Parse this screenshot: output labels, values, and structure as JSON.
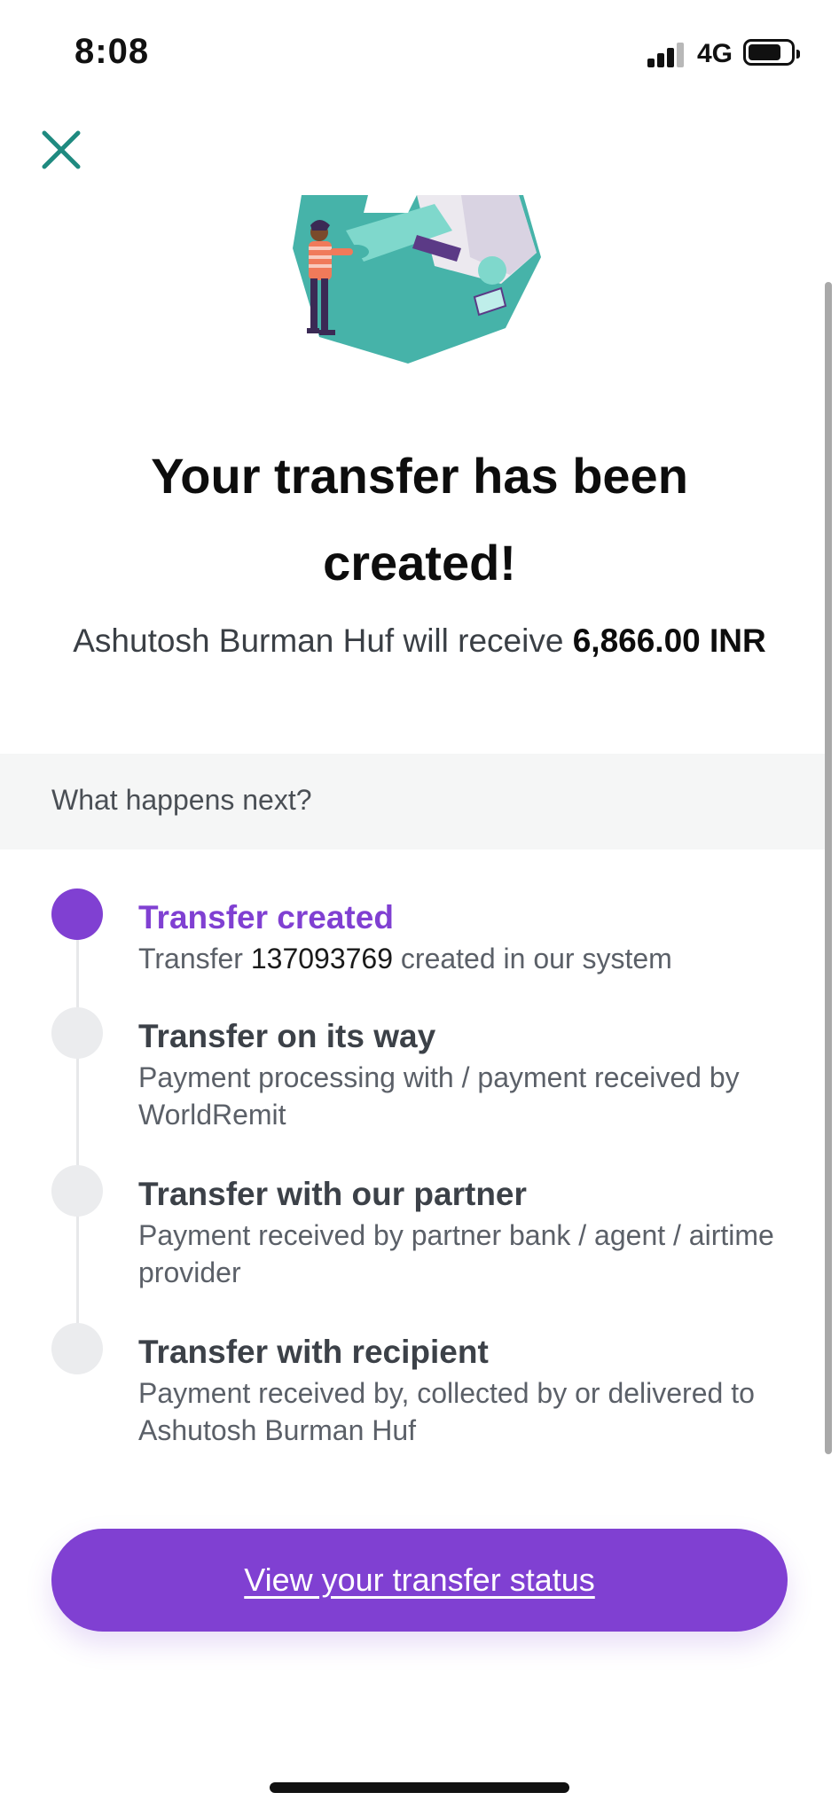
{
  "status_bar": {
    "time": "8:08",
    "network": "4G"
  },
  "header": {
    "close_icon": "close-icon"
  },
  "hero": {
    "title": "Your transfer has been created!",
    "receive_prefix": "Ashutosh Burman Huf will receive ",
    "receive_amount": "6,866.00 INR"
  },
  "next_section": {
    "label": "What happens next?"
  },
  "steps": [
    {
      "title": "Transfer created",
      "desc_prefix": "Transfer ",
      "transfer_number": "137093769",
      "desc_suffix": " created in our system",
      "active": true
    },
    {
      "title": "Transfer on its way",
      "desc": "Payment processing with / payment received by WorldRemit",
      "active": false
    },
    {
      "title": "Transfer with our partner",
      "desc": "Payment received by partner bank / agent / airtime provider",
      "active": false
    },
    {
      "title": "Transfer with recipient",
      "desc": "Payment received by, collected by or delivered to Ashutosh Burman Huf",
      "active": false
    }
  ],
  "cta": {
    "label": "View your transfer status"
  },
  "colors": {
    "accent": "#8040d2",
    "teal": "#2a9d8f",
    "step_inactive": "#ebecee"
  }
}
